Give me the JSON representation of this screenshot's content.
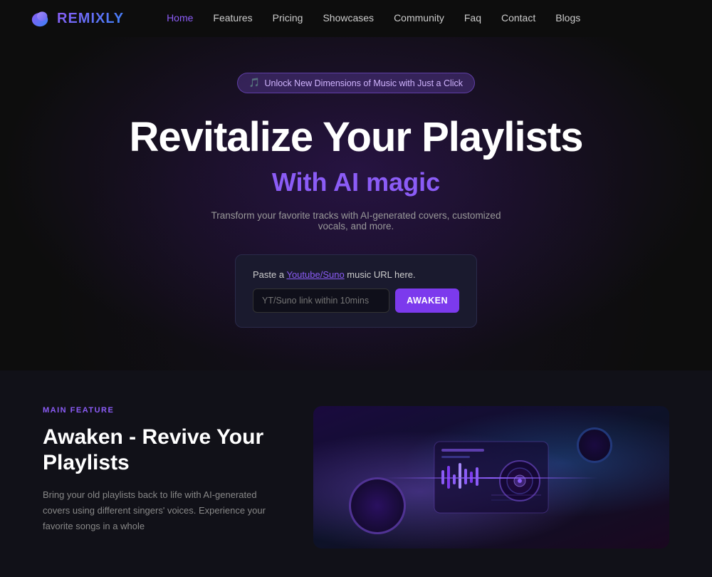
{
  "nav": {
    "logo_text": "REMIXLY",
    "links": [
      {
        "label": "Home",
        "active": true
      },
      {
        "label": "Features",
        "active": false
      },
      {
        "label": "Pricing",
        "active": false
      },
      {
        "label": "Showcases",
        "active": false
      },
      {
        "label": "Community",
        "active": false
      },
      {
        "label": "Faq",
        "active": false
      },
      {
        "label": "Contact",
        "active": false
      },
      {
        "label": "Blogs",
        "active": false
      }
    ]
  },
  "hero": {
    "badge_emoji": "🎵",
    "badge_text": "Unlock New Dimensions of Music with Just a Click",
    "title": "Revitalize Your Playlists",
    "subtitle": "With AI magic",
    "description": "Transform your favorite tracks with AI-generated covers, customized vocals, and more.",
    "url_label_text": "Paste a ",
    "url_link_text": "Youtube/Suno",
    "url_label_suffix": " music URL here.",
    "input_placeholder": "YT/Suno link within 10mins",
    "awaken_btn": "AWAKEN"
  },
  "features": {
    "section_label": "MAIN FEATURE",
    "title": "Awaken - Revive Your Playlists",
    "description": "Bring your old playlists back to life with AI-generated covers using different singers' voices. Experience your favorite songs in a whole"
  },
  "colors": {
    "accent": "#8b5cf6",
    "accent_dark": "#7c3aed",
    "bg": "#0d0d0d",
    "bg2": "#111118"
  }
}
